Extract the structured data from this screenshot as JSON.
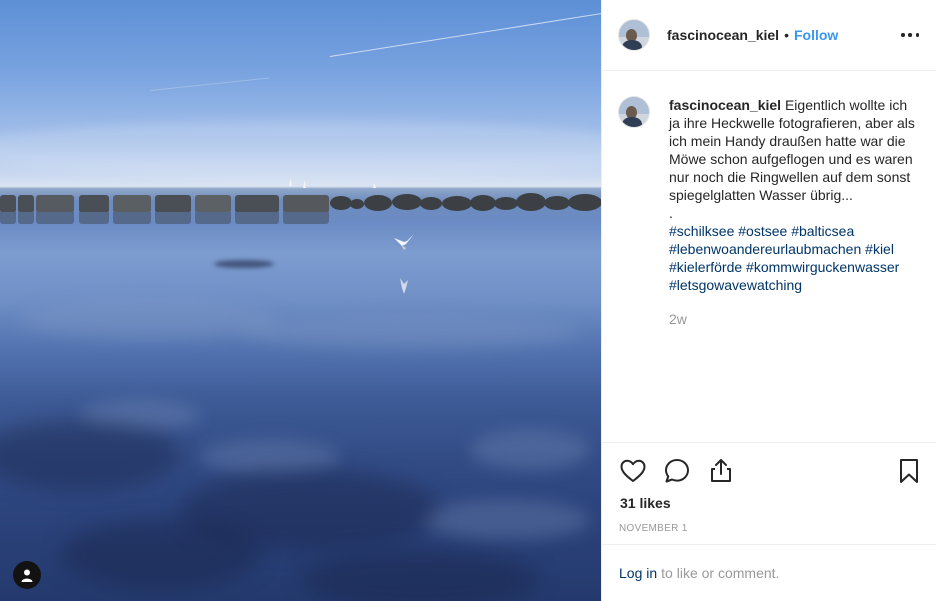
{
  "post": {
    "username": "fascinocean_kiel",
    "separator": "•",
    "follow_label": "Follow",
    "caption_text": "Eigentlich wollte ich ja ihre Heckwelle fotografieren, aber als ich mein Handy draußen hatte war die Möwe schon aufgeflogen und es waren nur noch die Ringwellen auf dem sonst spiegelglatten Wasser übrig...",
    "caption_dot": ".",
    "hashtags": [
      "#schilksee",
      "#ostsee",
      "#balticsea",
      "#lebenwoandereurlaubmachen",
      "#kiel",
      "#kielerförde",
      "#kommwirguckenwasser",
      "#letsgowavewatching"
    ],
    "time_ago": "2w",
    "likes": "31 likes",
    "date": "NOVEMBER 1"
  },
  "login": {
    "link_label": "Log in",
    "rest_text": "to like or comment."
  },
  "icons": {
    "more": "more-options-icon",
    "like": "heart-icon",
    "comment": "comment-icon",
    "share": "share-icon",
    "save": "bookmark-icon",
    "profile": "user-icon"
  },
  "colors": {
    "accent": "#3897f0",
    "link": "#003569",
    "muted": "#999999",
    "text": "#262626"
  }
}
